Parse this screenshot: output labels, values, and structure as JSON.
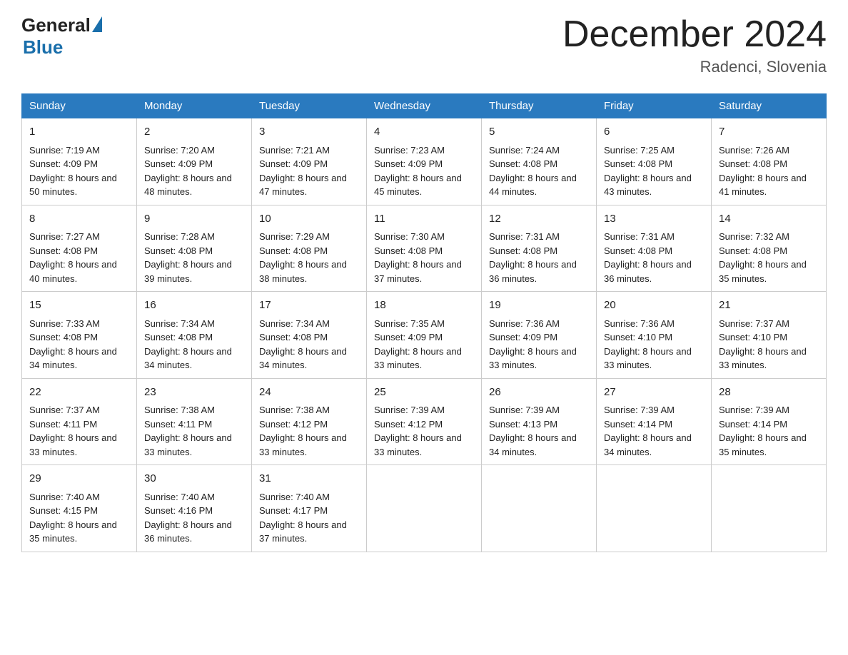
{
  "logo": {
    "general": "General",
    "blue": "Blue"
  },
  "title": "December 2024",
  "location": "Radenci, Slovenia",
  "days_of_week": [
    "Sunday",
    "Monday",
    "Tuesday",
    "Wednesday",
    "Thursday",
    "Friday",
    "Saturday"
  ],
  "weeks": [
    [
      {
        "day": "1",
        "sunrise": "7:19 AM",
        "sunset": "4:09 PM",
        "daylight": "8 hours and 50 minutes."
      },
      {
        "day": "2",
        "sunrise": "7:20 AM",
        "sunset": "4:09 PM",
        "daylight": "8 hours and 48 minutes."
      },
      {
        "day": "3",
        "sunrise": "7:21 AM",
        "sunset": "4:09 PM",
        "daylight": "8 hours and 47 minutes."
      },
      {
        "day": "4",
        "sunrise": "7:23 AM",
        "sunset": "4:09 PM",
        "daylight": "8 hours and 45 minutes."
      },
      {
        "day": "5",
        "sunrise": "7:24 AM",
        "sunset": "4:08 PM",
        "daylight": "8 hours and 44 minutes."
      },
      {
        "day": "6",
        "sunrise": "7:25 AM",
        "sunset": "4:08 PM",
        "daylight": "8 hours and 43 minutes."
      },
      {
        "day": "7",
        "sunrise": "7:26 AM",
        "sunset": "4:08 PM",
        "daylight": "8 hours and 41 minutes."
      }
    ],
    [
      {
        "day": "8",
        "sunrise": "7:27 AM",
        "sunset": "4:08 PM",
        "daylight": "8 hours and 40 minutes."
      },
      {
        "day": "9",
        "sunrise": "7:28 AM",
        "sunset": "4:08 PM",
        "daylight": "8 hours and 39 minutes."
      },
      {
        "day": "10",
        "sunrise": "7:29 AM",
        "sunset": "4:08 PM",
        "daylight": "8 hours and 38 minutes."
      },
      {
        "day": "11",
        "sunrise": "7:30 AM",
        "sunset": "4:08 PM",
        "daylight": "8 hours and 37 minutes."
      },
      {
        "day": "12",
        "sunrise": "7:31 AM",
        "sunset": "4:08 PM",
        "daylight": "8 hours and 36 minutes."
      },
      {
        "day": "13",
        "sunrise": "7:31 AM",
        "sunset": "4:08 PM",
        "daylight": "8 hours and 36 minutes."
      },
      {
        "day": "14",
        "sunrise": "7:32 AM",
        "sunset": "4:08 PM",
        "daylight": "8 hours and 35 minutes."
      }
    ],
    [
      {
        "day": "15",
        "sunrise": "7:33 AM",
        "sunset": "4:08 PM",
        "daylight": "8 hours and 34 minutes."
      },
      {
        "day": "16",
        "sunrise": "7:34 AM",
        "sunset": "4:08 PM",
        "daylight": "8 hours and 34 minutes."
      },
      {
        "day": "17",
        "sunrise": "7:34 AM",
        "sunset": "4:08 PM",
        "daylight": "8 hours and 34 minutes."
      },
      {
        "day": "18",
        "sunrise": "7:35 AM",
        "sunset": "4:09 PM",
        "daylight": "8 hours and 33 minutes."
      },
      {
        "day": "19",
        "sunrise": "7:36 AM",
        "sunset": "4:09 PM",
        "daylight": "8 hours and 33 minutes."
      },
      {
        "day": "20",
        "sunrise": "7:36 AM",
        "sunset": "4:10 PM",
        "daylight": "8 hours and 33 minutes."
      },
      {
        "day": "21",
        "sunrise": "7:37 AM",
        "sunset": "4:10 PM",
        "daylight": "8 hours and 33 minutes."
      }
    ],
    [
      {
        "day": "22",
        "sunrise": "7:37 AM",
        "sunset": "4:11 PM",
        "daylight": "8 hours and 33 minutes."
      },
      {
        "day": "23",
        "sunrise": "7:38 AM",
        "sunset": "4:11 PM",
        "daylight": "8 hours and 33 minutes."
      },
      {
        "day": "24",
        "sunrise": "7:38 AM",
        "sunset": "4:12 PM",
        "daylight": "8 hours and 33 minutes."
      },
      {
        "day": "25",
        "sunrise": "7:39 AM",
        "sunset": "4:12 PM",
        "daylight": "8 hours and 33 minutes."
      },
      {
        "day": "26",
        "sunrise": "7:39 AM",
        "sunset": "4:13 PM",
        "daylight": "8 hours and 34 minutes."
      },
      {
        "day": "27",
        "sunrise": "7:39 AM",
        "sunset": "4:14 PM",
        "daylight": "8 hours and 34 minutes."
      },
      {
        "day": "28",
        "sunrise": "7:39 AM",
        "sunset": "4:14 PM",
        "daylight": "8 hours and 35 minutes."
      }
    ],
    [
      {
        "day": "29",
        "sunrise": "7:40 AM",
        "sunset": "4:15 PM",
        "daylight": "8 hours and 35 minutes."
      },
      {
        "day": "30",
        "sunrise": "7:40 AM",
        "sunset": "4:16 PM",
        "daylight": "8 hours and 36 minutes."
      },
      {
        "day": "31",
        "sunrise": "7:40 AM",
        "sunset": "4:17 PM",
        "daylight": "8 hours and 37 minutes."
      },
      null,
      null,
      null,
      null
    ]
  ]
}
